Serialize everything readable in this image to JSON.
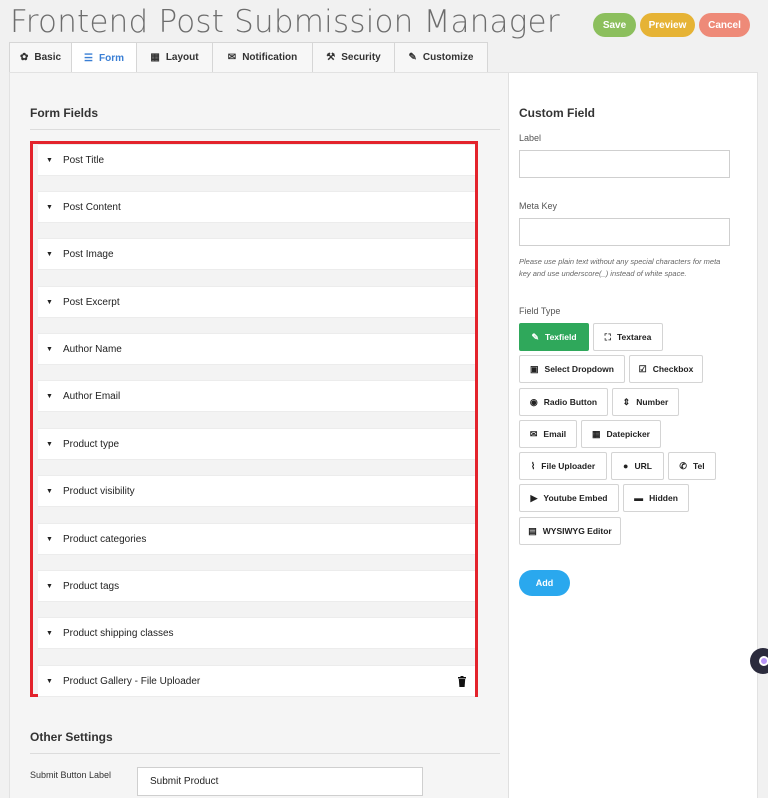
{
  "page": {
    "title": "Frontend Post Submission Manager"
  },
  "actions": {
    "save": "Save",
    "preview": "Preview",
    "cancel": "Cancel"
  },
  "tabs": [
    {
      "label": "Basic",
      "icon": "gear-icon"
    },
    {
      "label": "Form",
      "icon": "form-icon"
    },
    {
      "label": "Layout",
      "icon": "layout-icon"
    },
    {
      "label": "Notification",
      "icon": "envelope-icon"
    },
    {
      "label": "Security",
      "icon": "shield-icon"
    },
    {
      "label": "Customize",
      "icon": "brush-icon"
    }
  ],
  "form_fields": {
    "title": "Form Fields",
    "items": [
      "Post Title",
      "Post Content",
      "Post Image",
      "Post Excerpt",
      "Author Name",
      "Author Email",
      "Product type",
      "Product visibility",
      "Product categories",
      "Product tags",
      "Product shipping classes",
      "Product Gallery - File Uploader"
    ]
  },
  "other_settings": {
    "title": "Other Settings",
    "submit_label": "Submit Button Label",
    "submit_value": "Submit Product"
  },
  "custom_field": {
    "title": "Custom Field",
    "label": "Label",
    "meta_key": "Meta Key",
    "hint": "Please use plain text without any special characters for meta key and use underscore(_) instead of white space.",
    "field_type": "Field Type",
    "types": [
      {
        "label": "Texfield",
        "icon": "edit-icon"
      },
      {
        "label": "Textarea",
        "icon": "expand-icon"
      },
      {
        "label": "Select Dropdown",
        "icon": "dropdown-icon"
      },
      {
        "label": "Checkbox",
        "icon": "checkbox-icon"
      },
      {
        "label": "Radio Button",
        "icon": "radio-icon"
      },
      {
        "label": "Number",
        "icon": "sort-icon"
      },
      {
        "label": "Email",
        "icon": "envelope-icon"
      },
      {
        "label": "Datepicker",
        "icon": "calendar-icon"
      },
      {
        "label": "File Uploader",
        "icon": "paperclip-icon"
      },
      {
        "label": "URL",
        "icon": "globe-icon"
      },
      {
        "label": "Tel",
        "icon": "phone-icon"
      },
      {
        "label": "Youtube Embed",
        "icon": "youtube-icon"
      },
      {
        "label": "Hidden",
        "icon": "minus-icon"
      },
      {
        "label": "WYSIWYG Editor",
        "icon": "document-icon"
      }
    ],
    "add": "Add"
  }
}
